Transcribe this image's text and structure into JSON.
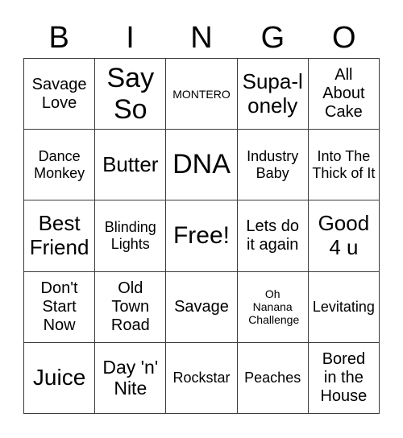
{
  "header": {
    "letters": [
      "B",
      "I",
      "N",
      "G",
      "O"
    ]
  },
  "grid": {
    "rows": [
      [
        "Savage Love",
        "Say So",
        "MONTERO",
        "Supa-lonely",
        "All About Cake"
      ],
      [
        "Dance Monkey",
        "Butter",
        "DNA",
        "Industry Baby",
        "Into The Thick of It"
      ],
      [
        "Best Friend",
        "Blinding Lights",
        "Free!",
        "Lets do it again",
        "Good 4 u"
      ],
      [
        "Don't Start Now",
        "Old Town Road",
        "Savage",
        "Oh Nanana Challenge",
        "Levitating"
      ],
      [
        "Juice",
        "Day 'n' Nite",
        "Rockstar",
        "Peaches",
        "Bored in the House"
      ]
    ],
    "free_space": "Free!"
  },
  "colors": {
    "grid_line": "#3a3a3a",
    "text": "#000000",
    "background": "#ffffff"
  }
}
